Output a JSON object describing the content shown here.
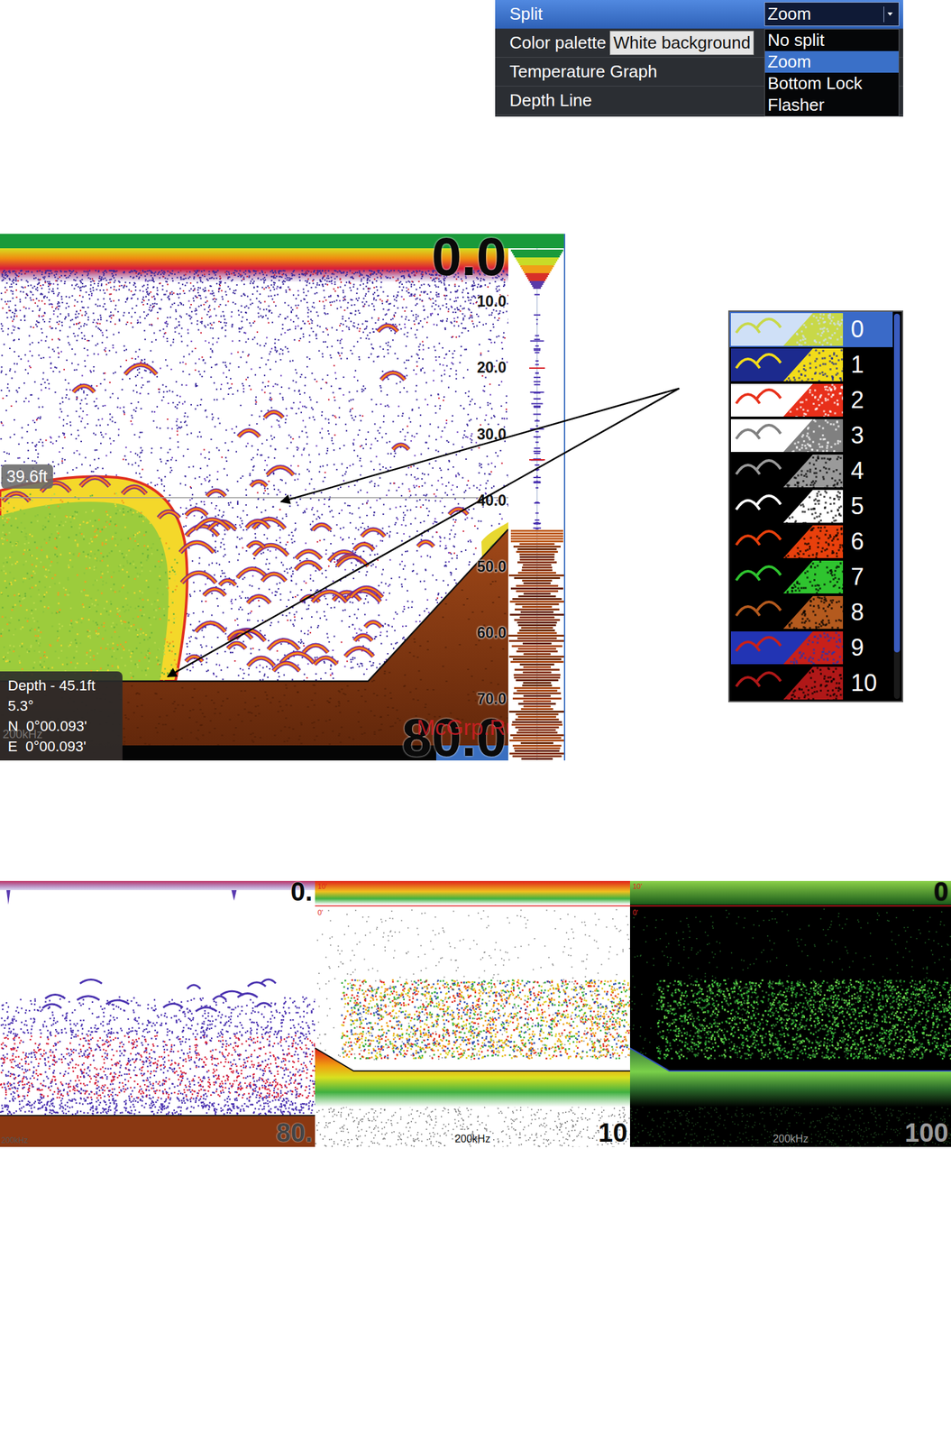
{
  "settings_menu": {
    "rows": [
      {
        "label": "Split",
        "value": "Zoom",
        "selected": true,
        "expanded": true
      },
      {
        "label": "Color palette",
        "value": "White background",
        "selected": false,
        "expanded": false
      },
      {
        "label": "Temperature Graph",
        "selected": false,
        "expanded": false
      },
      {
        "label": "Depth Line",
        "selected": false,
        "expanded": false
      }
    ],
    "dropdown_options": [
      {
        "label": "No split",
        "selected": false
      },
      {
        "label": "Zoom",
        "selected": true
      },
      {
        "label": "Bottom Lock",
        "selected": false
      },
      {
        "label": "Flasher",
        "selected": false
      }
    ]
  },
  "sonar_view": {
    "depth_readout": "0.0",
    "range_readout": "80.0",
    "scale": [
      {
        "label": "10.0",
        "depth": 10
      },
      {
        "label": "20.0",
        "depth": 20
      },
      {
        "label": "30.0",
        "depth": 30
      },
      {
        "label": "40.0",
        "depth": 40
      },
      {
        "label": "50.0",
        "depth": 50
      },
      {
        "label": "60.0",
        "depth": 60
      },
      {
        "label": "70.0",
        "depth": 70
      }
    ],
    "cursor": {
      "label": "39.6ft",
      "depth": 39.6
    },
    "info": [
      "Depth - 45.1ft",
      "5.3°",
      "N  0°00.093'",
      "E  0°00.093'"
    ],
    "frequency": "200kHz",
    "watermark": "McGrp.Ru"
  },
  "palette_list": {
    "scrollbar_level": 0.88,
    "items": [
      {
        "label": "0",
        "selected": true,
        "background": "#cfe0f7",
        "color": "#c8d848"
      },
      {
        "label": "1",
        "selected": false,
        "background": "#1c2a8e",
        "color": "#f2dc1a"
      },
      {
        "label": "2",
        "selected": false,
        "background": "#ffffff",
        "color": "#e8301a"
      },
      {
        "label": "3",
        "selected": false,
        "background": "#ffffff",
        "color": "#808080"
      },
      {
        "label": "4",
        "selected": false,
        "background": "#000000",
        "color": "#9a9a9a"
      },
      {
        "label": "5",
        "selected": false,
        "background": "#000000",
        "color": "#ffffff"
      },
      {
        "label": "6",
        "selected": false,
        "background": "#000000",
        "color": "#e8400c"
      },
      {
        "label": "7",
        "selected": false,
        "background": "#000000",
        "color": "#2fc42f"
      },
      {
        "label": "8",
        "selected": false,
        "background": "#000000",
        "color": "#b45a1e"
      },
      {
        "label": "9",
        "selected": false,
        "background": "#2234b4",
        "color": "#c8201a"
      },
      {
        "label": "10",
        "selected": false,
        "background": "#000000",
        "color": "#b01818"
      }
    ]
  },
  "example_views": [
    {
      "kind": "white",
      "depth_readout": "0.",
      "range_readout": "80.",
      "frequency": "200kHz",
      "scale_labels": []
    },
    {
      "kind": "zoom-white",
      "range_readout": "10",
      "frequency": "200kHz",
      "scale_labels": [
        "10'",
        "0'"
      ]
    },
    {
      "kind": "zoom-black",
      "depth_readout": "0",
      "range_readout": "100",
      "frequency": "200kHz",
      "scale_labels": [
        "10'",
        "0'"
      ]
    }
  ]
}
